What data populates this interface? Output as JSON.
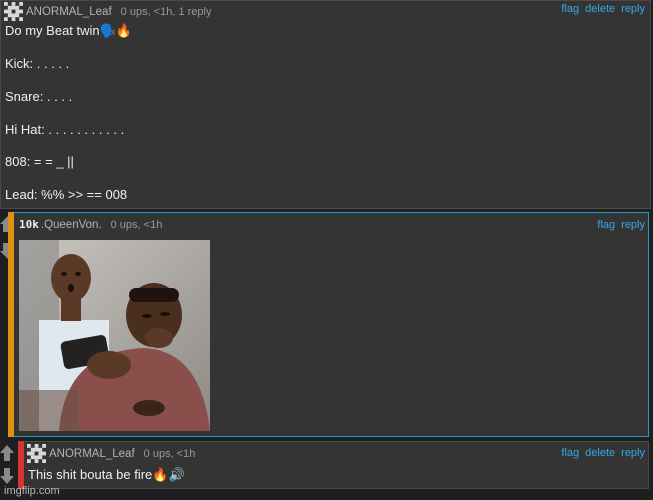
{
  "comments": [
    {
      "username": "ANORMAL_Leaf",
      "meta": "0 ups, <1h, 1 reply",
      "actions": [
        "flag",
        "delete",
        "reply"
      ],
      "lines": [
        "Do my Beat twin🗣️🔥",
        "Kick: . . . . .",
        "Snare: . . . .",
        "Hi Hat: . . . . . . . . . . .",
        "808: = = _ ||",
        "Lead: %% >> == 008"
      ]
    },
    {
      "badge": "10k",
      "username": ".QueenVon.",
      "meta": "0 ups, <1h",
      "actions": [
        "flag",
        "reply"
      ],
      "image": "reaction-meme-photo"
    },
    {
      "username": "ANORMAL_Leaf",
      "meta": "0 ups, <1h",
      "actions": [
        "flag",
        "delete",
        "reply"
      ],
      "lines": [
        "This shit bouta be fire🔥🔊"
      ]
    }
  ],
  "watermark": "imgflip.com",
  "colors": {
    "link": "#3aa8e6",
    "reply_bar": "#e3900f",
    "own_bar": "#d63333",
    "highlight_border": "#1f9fc8"
  }
}
